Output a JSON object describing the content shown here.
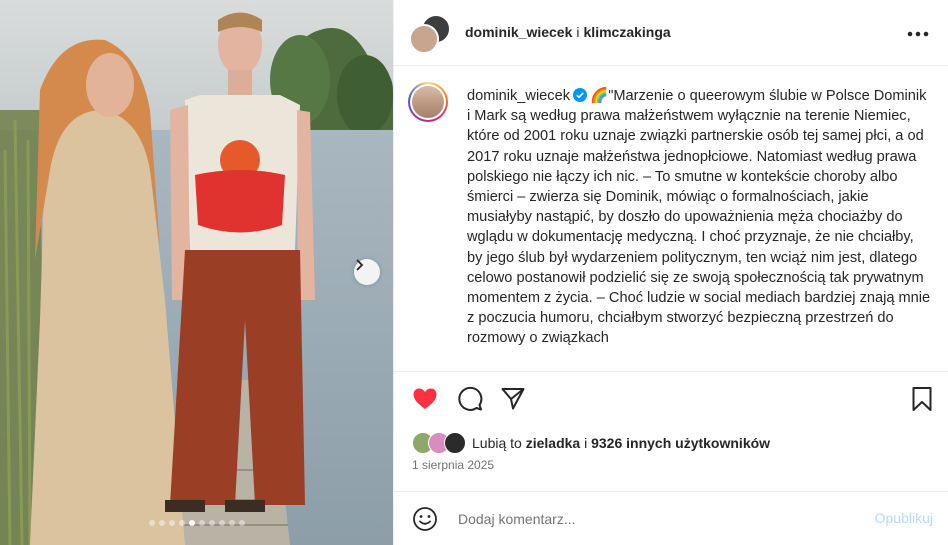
{
  "header": {
    "user1": "dominik_wiecek",
    "separator": "i",
    "user2": "klimczakinga",
    "more_icon": "more-horizontal-icon"
  },
  "caption": {
    "username": "dominik_wiecek",
    "emoji": "🌈",
    "text": "\"Marzenie o queerowym ślubie w Polsce Dominik i Mark są według prawa małżeństwem wyłącznie na terenie Niemiec, które od 2001 roku uznaje związki partnerskie osób tej samej płci, a od 2017 roku uznaje małżeństwa jednopłciowe. Natomiast według prawa polskiego nie łączy ich nic. – To smutne w kontekście choroby albo śmierci – zwierza się Dominik, mówiąc o formalnościach, jakie musiałyby nastąpić, by doszło do upoważnienia męża chociażby do wglądu w dokumentację medyczną. I choć przyznaje, że nie chciałby, by jego ślub był wydarzeniem politycznym, ten wciąż nim jest, dlatego celowo postanowił podzielić się ze swoją społecznością tak prywatnym momentem z życia. – Choć ludzie w social mediach bardziej znają mnie z poczucia humoru, chciałbym stworzyć bezpieczną przestrzeń do rozmowy o związkach"
  },
  "likes": {
    "prefix": "Lubią to",
    "user": "zieladka",
    "middle": "i",
    "count_text": "9326 innych użytkowników"
  },
  "date": "1 sierpnia 2025",
  "comment": {
    "placeholder": "Dodaj komentarz...",
    "publish": "Opublikuj"
  },
  "carousel": {
    "total": 10,
    "active_index": 4
  },
  "colors": {
    "like_red": "#ff3040",
    "verified_blue": "#0095f6",
    "publish_disabled": "#b3dbff"
  }
}
